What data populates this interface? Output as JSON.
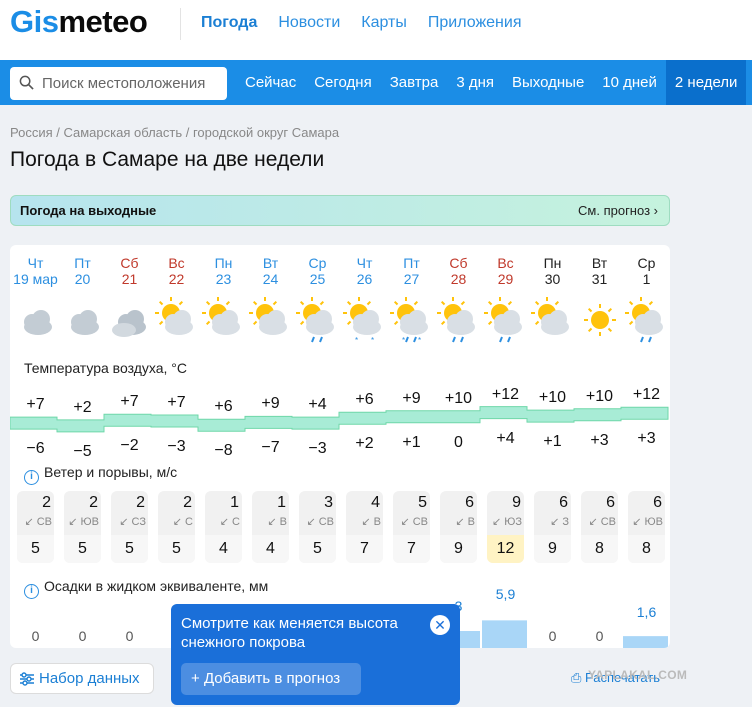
{
  "header": {
    "logo_prefix": "Gis",
    "logo_suffix": "meteo",
    "nav": [
      "Погода",
      "Новости",
      "Карты",
      "Приложения"
    ]
  },
  "search": {
    "placeholder": "Поиск местоположения"
  },
  "periods": [
    "Сейчас",
    "Сегодня",
    "Завтра",
    "3 дня",
    "Выходные",
    "10 дней",
    "2 недели"
  ],
  "breadcrumb": "Россия / Самарская область / городской округ Самара",
  "page_title": "Погода в Самаре на две недели",
  "banner": {
    "title": "Погода на выходные",
    "link": "См. прогноз"
  },
  "days": [
    {
      "dow": "Чт",
      "date": "19 мар",
      "type": "weekday",
      "icon": "cloudy-sun-icon",
      "tmax": "+7",
      "tmin": "−6",
      "wind": "2",
      "dir": "СВ",
      "gust": "5",
      "precip": "0"
    },
    {
      "dow": "Пт",
      "date": "20",
      "type": "weekday",
      "icon": "cloudy-sun-icon",
      "tmax": "+2",
      "tmin": "−5",
      "wind": "2",
      "dir": "ЮВ",
      "gust": "5",
      "precip": "0"
    },
    {
      "dow": "Сб",
      "date": "21",
      "type": "weekend",
      "icon": "cloudy-icon",
      "tmax": "+7",
      "tmin": "−2",
      "wind": "2",
      "dir": "СЗ",
      "gust": "5",
      "precip": "0"
    },
    {
      "dow": "Вс",
      "date": "22",
      "type": "weekend",
      "icon": "partly-cloudy-icon",
      "tmax": "+7",
      "tmin": "−3",
      "wind": "2",
      "dir": "С",
      "gust": "5",
      "precip": ""
    },
    {
      "dow": "Пн",
      "date": "23",
      "type": "weekday",
      "icon": "partly-cloudy-icon",
      "tmax": "+6",
      "tmin": "−8",
      "wind": "1",
      "dir": "С",
      "gust": "4",
      "precip": ""
    },
    {
      "dow": "Вт",
      "date": "24",
      "type": "weekday",
      "icon": "partly-cloudy-icon",
      "tmax": "+9",
      "tmin": "−7",
      "wind": "1",
      "dir": "В",
      "gust": "4",
      "precip": ""
    },
    {
      "dow": "Ср",
      "date": "25",
      "type": "weekday",
      "icon": "rain-icon",
      "tmax": "+4",
      "tmin": "−3",
      "wind": "3",
      "dir": "СВ",
      "gust": "5",
      "precip": ""
    },
    {
      "dow": "Чт",
      "date": "26",
      "type": "weekday",
      "icon": "snow-icon",
      "tmax": "+6",
      "tmin": "+2",
      "wind": "4",
      "dir": "В",
      "gust": "7",
      "precip": ""
    },
    {
      "dow": "Пт",
      "date": "27",
      "type": "weekday",
      "icon": "snow-rain-icon",
      "tmax": "+9",
      "tmin": "+1",
      "wind": "5",
      "dir": "СВ",
      "gust": "7",
      "precip": ""
    },
    {
      "dow": "Сб",
      "date": "28",
      "type": "weekend",
      "icon": "rain-icon",
      "tmax": "+10",
      "tmin": "0",
      "wind": "6",
      "dir": "В",
      "gust": "9",
      "precip": "3"
    },
    {
      "dow": "Вс",
      "date": "29",
      "type": "weekend",
      "icon": "rain-icon",
      "tmax": "+12",
      "tmin": "+4",
      "wind": "9",
      "dir": "ЮЗ",
      "gust": "12",
      "precip": "5,9"
    },
    {
      "dow": "Пн",
      "date": "30",
      "type": "plain",
      "icon": "partly-cloudy-icon",
      "tmax": "+10",
      "tmin": "+1",
      "wind": "6",
      "dir": "З",
      "gust": "9",
      "precip": "0"
    },
    {
      "dow": "Вт",
      "date": "31",
      "type": "plain",
      "icon": "sun-icon",
      "tmax": "+10",
      "tmin": "+3",
      "wind": "6",
      "dir": "СВ",
      "gust": "8",
      "precip": "0"
    },
    {
      "dow": "Ср",
      "date": "1",
      "type": "plain",
      "icon": "rain-icon",
      "tmax": "+12",
      "tmin": "+3",
      "wind": "6",
      "dir": "ЮВ",
      "gust": "8",
      "precip": "1,6"
    }
  ],
  "sections": {
    "temperature": "Температура воздуха, °C",
    "wind": "Ветер и порывы, м/с",
    "precip": "Осадки в жидком эквиваленте, мм"
  },
  "popup": {
    "message": "Смотрите как меняется высота снежного покрова",
    "add_button": "Добавить в прогноз"
  },
  "dataset_button": "Набор данных",
  "print_link": "Распечатать",
  "watermark": "YAPLAKAL.COM",
  "colors": {
    "brand": "#1b8de6",
    "weekend": "#c0392b",
    "temp_band": "#a8ecd6"
  }
}
